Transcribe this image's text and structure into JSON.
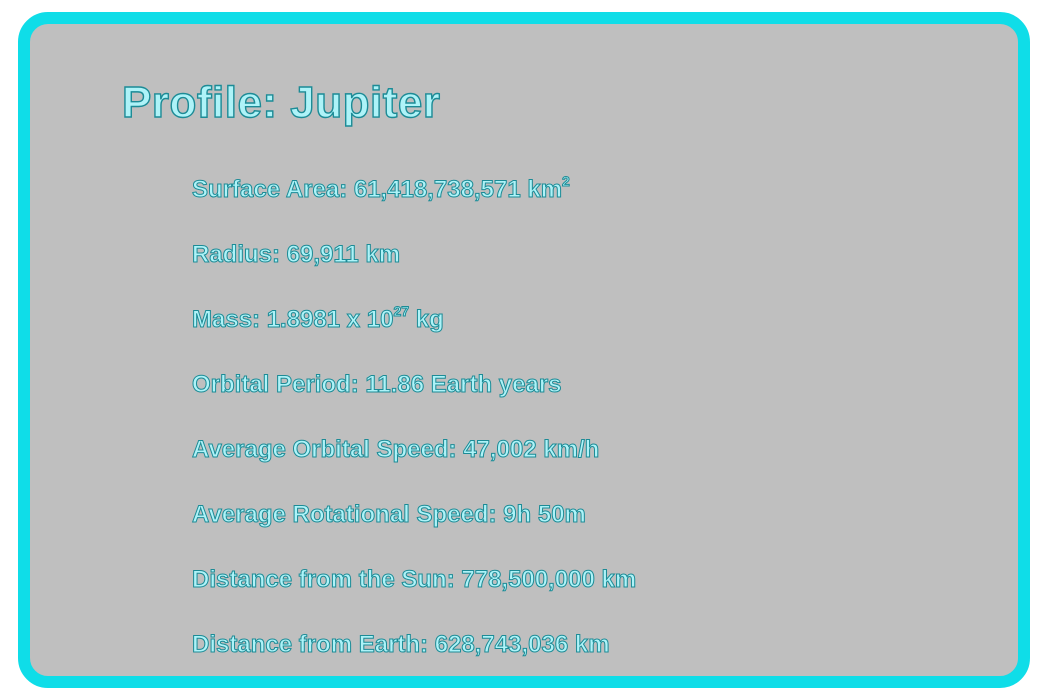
{
  "profile": {
    "title": "Profile: Jupiter"
  },
  "facts": {
    "surface_area": {
      "label": "Surface Area: 61,418,738,571 km",
      "sup": "2",
      "suffix": ""
    },
    "radius": {
      "text": "Radius: 69,911 km"
    },
    "mass": {
      "label": "Mass: 1.8981 x 10",
      "sup": "27",
      "suffix": " kg"
    },
    "orbital_period": {
      "text": "Orbital Period: 11.86 Earth years"
    },
    "average_orbital_speed": {
      "text": "Average Orbital Speed: 47,002 km/h"
    },
    "average_rotational_speed": {
      "text": "Average Rotational Speed: 9h 50m"
    },
    "distance_from_sun": {
      "text": "Distance from the Sun: 778,500,000 km"
    },
    "distance_from_earth": {
      "text": "Distance from Earth: 628,743,036 km"
    }
  },
  "colors": {
    "frame_border": "#0fdde8",
    "panel_background": "#bfbfbf",
    "text_fill": "#aef3f8",
    "text_outline": "#1c8b96"
  }
}
